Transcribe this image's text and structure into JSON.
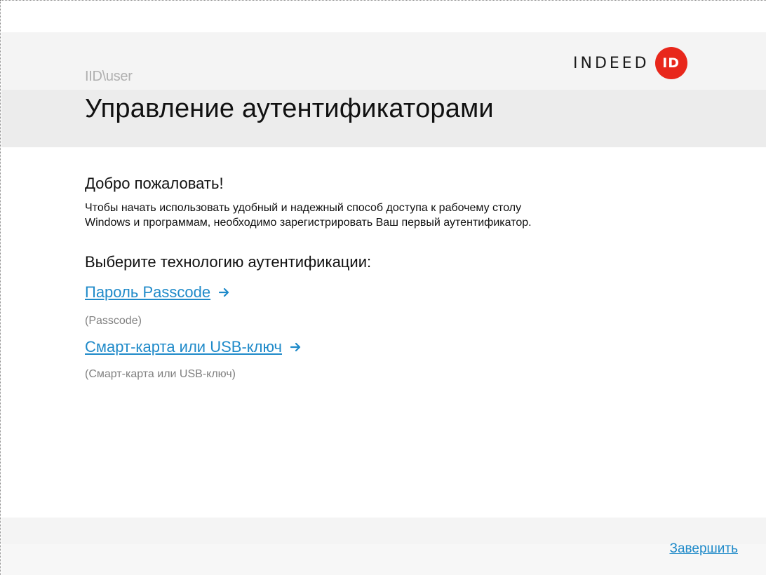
{
  "header": {
    "user": "IID\\user",
    "title": "Управление аутентификаторами",
    "logo": {
      "text": "INDEED",
      "badge": "ID",
      "badge_color": "#e8271b"
    }
  },
  "welcome": {
    "title": "Добро пожаловать!",
    "line1": "Чтобы начать использовать удобный и надежный способ доступа к рабочему столу",
    "line2": "Windows и программам, необходимо зарегистрировать Ваш первый аутентификатор."
  },
  "choose_label": "Выберите технологию аутентификации:",
  "methods": [
    {
      "label": "Пароль Passcode",
      "subtitle": "(Passcode)",
      "icon": "arrow-right-icon"
    },
    {
      "label": "Смарт-карта или USB-ключ",
      "subtitle": "(Смарт-карта или USB-ключ)",
      "icon": "arrow-right-icon"
    }
  ],
  "footer": {
    "finish_label": "Завершить"
  },
  "colors": {
    "link": "#1f8ac9",
    "header_band": "#ececec",
    "accent": "#e8271b"
  }
}
